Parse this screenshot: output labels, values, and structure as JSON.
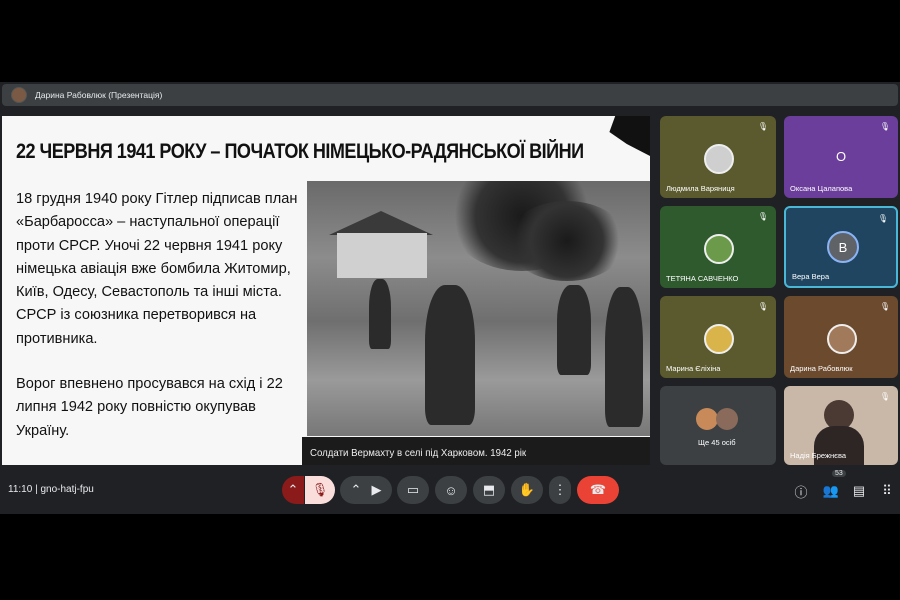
{
  "topbar": {
    "presenter_title": "Дарина Рабовлюк (Презентація)"
  },
  "slide": {
    "title": "22 ЧЕРВНЯ 1941 РОКУ – ПОЧАТОК НІМЕЦЬКО-РАДЯНСЬКОЇ ВІЙНИ",
    "paragraph1": "18 грудня 1940 року Гітлер підписав план «Барбаросса» – наступальної операції проти СРСР. Уночі 22 червня 1941 року німецька авіація вже бомбила Житомир, Київ, Одесу, Севастополь та інші міста.  СРСР із союзника перетворився на противника.",
    "paragraph2": "Ворог впевнено просувався на схід і 22 липня 1942 року повністю окупував Україну.",
    "photo_caption": "Солдати Вермахту в селі під Харковом. 1942 рік"
  },
  "participants": [
    {
      "name": "Людмила Варяниця"
    },
    {
      "name": "Оксана Цалапова",
      "initial": "О"
    },
    {
      "name": "ТЕТЯНА САВЧЕНКО"
    },
    {
      "name": "Вера Вера",
      "initial": "В"
    },
    {
      "name": "Марина Єліхіна"
    },
    {
      "name": "Дарина Рабовлюк"
    },
    {
      "name": "Ще 45 осіб"
    },
    {
      "name": "Надія Брежнєва"
    }
  ],
  "bottombar": {
    "time": "11:10",
    "meeting_code": "gno-hatj-fpu",
    "people_count": "53"
  },
  "colors": {
    "background": "#202124",
    "tile_olive": "#5b5a2e",
    "tile_green": "#2e5a2e",
    "tile_purple": "#6a3e9a",
    "tile_blue": "#1f4560",
    "tile_brown": "#6b4a2e",
    "end_call": "#ea4335",
    "mic_muted": "#f9dedc",
    "active_speaker_border": "#4ab7d6"
  }
}
